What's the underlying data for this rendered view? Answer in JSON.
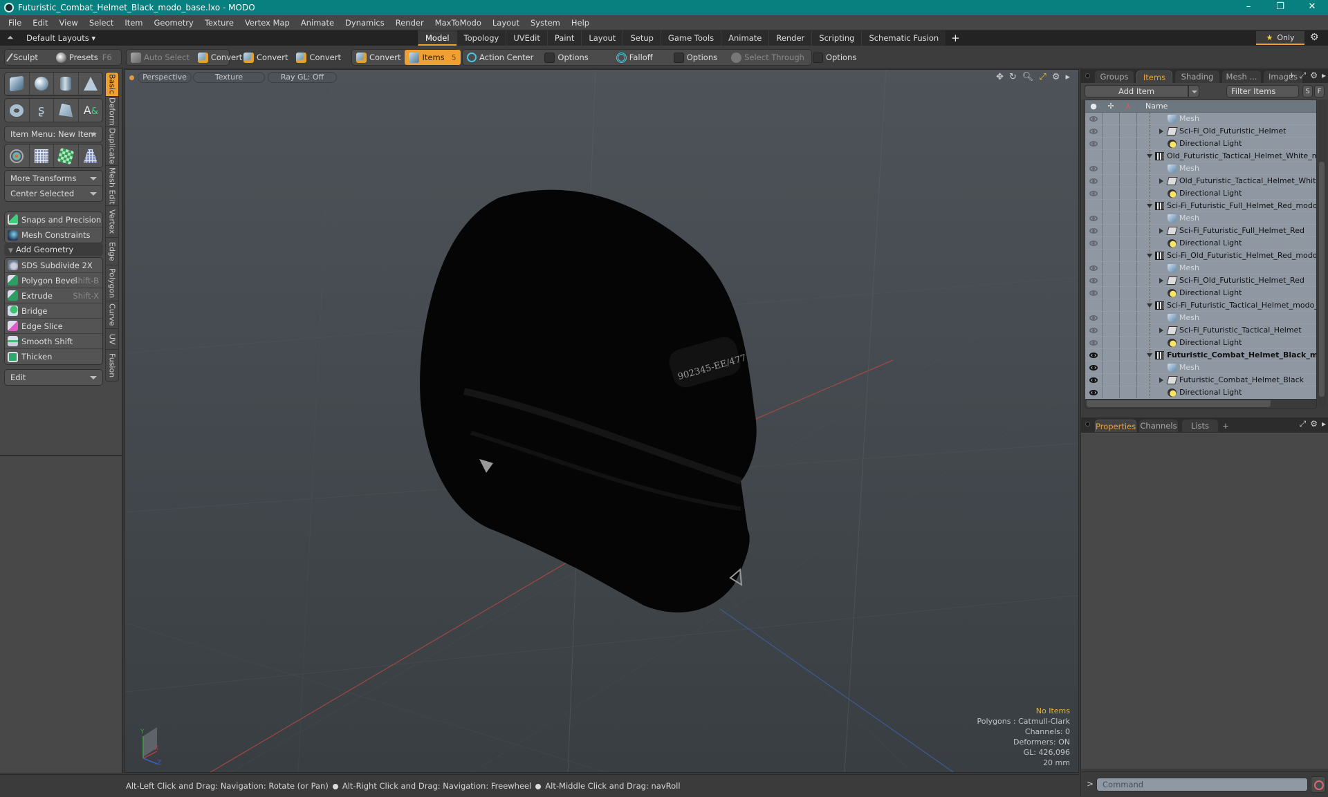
{
  "window": {
    "title": "Futuristic_Combat_Helmet_Black_modo_base.lxo - MODO",
    "controls": [
      "–",
      "❐",
      "✕"
    ]
  },
  "menubar": [
    "File",
    "Edit",
    "View",
    "Select",
    "Item",
    "Geometry",
    "Texture",
    "Vertex Map",
    "Animate",
    "Dynamics",
    "Render",
    "MaxToModo",
    "Layout",
    "System",
    "Help"
  ],
  "layoutbar": {
    "layout_select": "Default Layouts ▾",
    "tabs": [
      "Model",
      "Topology",
      "UVEdit",
      "Paint",
      "Layout",
      "Setup",
      "Game Tools",
      "Animate",
      "Render",
      "Scripting",
      "Schematic Fusion"
    ],
    "active_tab": "Model",
    "add_tab": "+",
    "only_label": "Only"
  },
  "toolbar": {
    "sculpt": "Sculpt",
    "presets": "Presets",
    "presets_shortcut": "F6",
    "auto_select": "Auto Select",
    "convert": "Convert",
    "items": "Items",
    "items_badge": "5",
    "action_center": "Action Center",
    "options": "Options",
    "falloff": "Falloff",
    "select_through": "Select Through"
  },
  "leftpanel": {
    "item_menu": "Item Menu: New Item",
    "more_transforms": "More Transforms",
    "center_selected": "Center Selected",
    "snaps": "Snaps and Precision",
    "mesh_constraints": "Mesh Constraints",
    "add_geometry": "Add Geometry",
    "tools": [
      {
        "label": "SDS Subdivide 2X",
        "shortcut": ""
      },
      {
        "label": "Polygon Bevel",
        "shortcut": "Shift-B"
      },
      {
        "label": "Extrude",
        "shortcut": "Shift-X"
      },
      {
        "label": "Bridge",
        "shortcut": ""
      },
      {
        "label": "Edge Slice",
        "shortcut": ""
      },
      {
        "label": "Smooth Shift",
        "shortcut": ""
      },
      {
        "label": "Thicken",
        "shortcut": ""
      }
    ],
    "edit_dropdown": "Edit",
    "vertical_tabs": [
      "Basic",
      "Deform",
      "Duplicate",
      "Mesh Edit",
      "Vertex",
      "Edge",
      "Polygon",
      "Curve",
      "UV",
      "Fusion"
    ],
    "active_vertical_tab": "Basic"
  },
  "viewport": {
    "view_mode": "Perspective",
    "shading": "Texture",
    "raygl": "Ray GL: Off",
    "helmet_label": "902345-EE/477",
    "info": {
      "selection": "No Items",
      "polygons": "Polygons : Catmull-Clark",
      "channels": "Channels: 0",
      "deformers": "Deformers: ON",
      "gl": "GL: 426,096",
      "scale": "20 mm"
    },
    "axis_labels": {
      "x": "X",
      "y": "Y",
      "z": "Z"
    }
  },
  "statusbar": {
    "hint1": "Alt-Left Click and Drag: Navigation: Rotate (or Pan)",
    "hint2": "Alt-Right Click and Drag: Navigation: Freewheel",
    "hint3": "Alt-Middle Click and Drag: navRoll"
  },
  "rightpanel": {
    "tabs": [
      "Groups",
      "Items",
      "Shading",
      "Mesh ...",
      "Images"
    ],
    "active_tab": "Items",
    "add_item": "Add Item",
    "filter_placeholder": "Filter Items",
    "s_btn": "S",
    "f_btn": "F",
    "column_name": "Name",
    "rows": [
      {
        "name": "Mesh",
        "type": "mesh",
        "depth": 2,
        "eye": "dim",
        "expander": "",
        "style": "dim"
      },
      {
        "name": "Sci-Fi_Old_Futuristic_Helmet",
        "type": "folder",
        "depth": 2,
        "eye": "dim",
        "expander": "right",
        "style": ""
      },
      {
        "name": "Directional Light",
        "type": "light",
        "depth": 2,
        "eye": "dim",
        "expander": "",
        "style": ""
      },
      {
        "name": "Old_Futuristic_Tactical_Helmet_White_mod…",
        "type": "scene",
        "depth": 1,
        "eye": "",
        "expander": "down",
        "style": ""
      },
      {
        "name": "Mesh",
        "type": "mesh",
        "depth": 2,
        "eye": "dim",
        "expander": "",
        "style": "dim"
      },
      {
        "name": "Old_Futuristic_Tactical_Helmet_White",
        "type": "folder",
        "depth": 2,
        "eye": "dim",
        "expander": "right",
        "style": ""
      },
      {
        "name": "Directional Light",
        "type": "light",
        "depth": 2,
        "eye": "dim",
        "expander": "",
        "style": ""
      },
      {
        "name": "Sci-Fi_Futuristic_Full_Helmet_Red_modo_b …",
        "type": "scene",
        "depth": 1,
        "eye": "",
        "expander": "down",
        "style": ""
      },
      {
        "name": "Mesh",
        "type": "mesh",
        "depth": 2,
        "eye": "dim",
        "expander": "",
        "style": "dim"
      },
      {
        "name": "Sci-Fi_Futuristic_Full_Helmet_Red",
        "type": "folder",
        "depth": 2,
        "eye": "dim",
        "expander": "right",
        "style": ""
      },
      {
        "name": "Directional Light",
        "type": "light",
        "depth": 2,
        "eye": "dim",
        "expander": "",
        "style": ""
      },
      {
        "name": "Sci-Fi_Old_Futuristic_Helmet_Red_modo_b …",
        "type": "scene",
        "depth": 1,
        "eye": "",
        "expander": "down",
        "style": ""
      },
      {
        "name": "Mesh",
        "type": "mesh",
        "depth": 2,
        "eye": "dim",
        "expander": "",
        "style": "dim"
      },
      {
        "name": "Sci-Fi_Old_Futuristic_Helmet_Red",
        "type": "folder",
        "depth": 2,
        "eye": "dim",
        "expander": "right",
        "style": ""
      },
      {
        "name": "Directional Light",
        "type": "light",
        "depth": 2,
        "eye": "dim",
        "expander": "",
        "style": ""
      },
      {
        "name": "Sci-Fi_Futuristic_Tactical_Helmet_modo_ba …",
        "type": "scene",
        "depth": 1,
        "eye": "",
        "expander": "down",
        "style": ""
      },
      {
        "name": "Mesh",
        "type": "mesh",
        "depth": 2,
        "eye": "dim",
        "expander": "",
        "style": "dim"
      },
      {
        "name": "Sci-Fi_Futuristic_Tactical_Helmet",
        "type": "folder",
        "depth": 2,
        "eye": "dim",
        "expander": "right",
        "style": ""
      },
      {
        "name": "Directional Light",
        "type": "light",
        "depth": 2,
        "eye": "dim",
        "expander": "",
        "style": ""
      },
      {
        "name": "Futuristic_Combat_Helmet_Black_m…",
        "type": "scene",
        "depth": 1,
        "eye": "on",
        "expander": "down",
        "style": "bold"
      },
      {
        "name": "Mesh",
        "type": "mesh",
        "depth": 2,
        "eye": "on",
        "expander": "",
        "style": "dim"
      },
      {
        "name": "Futuristic_Combat_Helmet_Black",
        "type": "folder",
        "depth": 2,
        "eye": "on",
        "expander": "right",
        "style": ""
      },
      {
        "name": "Directional Light",
        "type": "light",
        "depth": 2,
        "eye": "on",
        "expander": "",
        "style": ""
      }
    ],
    "props_tabs": [
      "Properties",
      "Channels",
      "Lists"
    ],
    "props_active": "Properties",
    "props_add": "+",
    "command_placeholder": "Command",
    "command_prompt": ">"
  },
  "colors": {
    "titlebar": "#08807f",
    "accent": "#f0a030"
  }
}
